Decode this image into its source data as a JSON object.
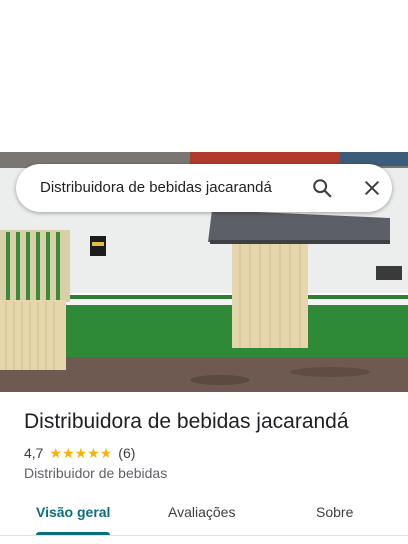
{
  "search": {
    "query": "Distribuidora de bebidas jacarandá"
  },
  "place": {
    "name": "Distribuidora de bebidas jacarandá",
    "rating_value": "4,7",
    "rating_stars": 4.7,
    "review_count": "(6)",
    "category": "Distribuidor de bebidas"
  },
  "tabs": [
    {
      "label": "Visão geral",
      "active": true
    },
    {
      "label": "Avaliações",
      "active": false
    },
    {
      "label": "Sobre",
      "active": false
    }
  ],
  "icons": {
    "search": "search-icon",
    "close": "close-icon",
    "star": "star-icon"
  },
  "colors": {
    "accent": "#0b6e7a",
    "star": "#f4b400",
    "wall_green": "#2e7d32",
    "wall_white": "#eef0f0",
    "door_beige": "#e6d6ae",
    "awning": "#54585e"
  }
}
